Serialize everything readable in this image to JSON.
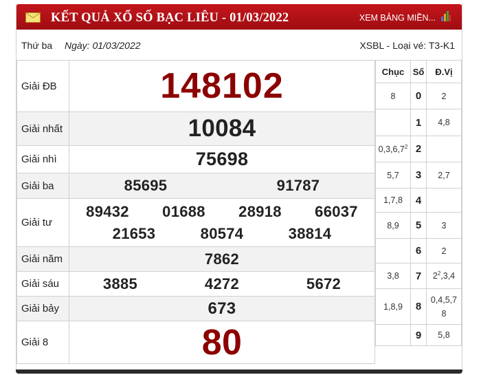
{
  "header": {
    "title": "KẾT QUẢ XỔ SỐ BẠC LIÊU - 01/03/2022",
    "more_link": "XEM BẢNG MIỀN...",
    "accent_color": "#c4161c"
  },
  "info": {
    "day": "Thứ ba",
    "date": "Ngày: 01/03/2022",
    "ticket": "XSBL - Loại vé: T3-K1"
  },
  "prizes": {
    "db": {
      "label": "Giải ĐB",
      "numbers": [
        "148102"
      ]
    },
    "g1": {
      "label": "Giải nhất",
      "numbers": [
        "10084"
      ]
    },
    "g2": {
      "label": "Giải nhì",
      "numbers": [
        "75698"
      ]
    },
    "g3": {
      "label": "Giải ba",
      "numbers": [
        "85695",
        "91787"
      ]
    },
    "g4": {
      "label": "Giải tư",
      "numbers": [
        "89432",
        "01688",
        "28918",
        "66037",
        "21653",
        "80574",
        "38814"
      ]
    },
    "g5": {
      "label": "Giải năm",
      "numbers": [
        "7862"
      ]
    },
    "g6": {
      "label": "Giải sáu",
      "numbers": [
        "3885",
        "4272",
        "5672"
      ]
    },
    "g7": {
      "label": "Giải bảy",
      "numbers": [
        "673"
      ]
    },
    "g8": {
      "label": "Giải 8",
      "numbers": [
        "80"
      ]
    }
  },
  "loto": {
    "headers": {
      "chuc": "Chục",
      "so": "Số",
      "dv": "Đ.Vị"
    },
    "rows": [
      {
        "chuc": "8",
        "so": "0",
        "dv": "2"
      },
      {
        "chuc": "",
        "so": "1",
        "dv": "4,8"
      },
      {
        "chuc": "0,3,6,7",
        "chuc_sup": "2",
        "so": "2",
        "dv": ""
      },
      {
        "chuc": "5,7",
        "so": "3",
        "dv": "2,7"
      },
      {
        "chuc": "1,7,8",
        "so": "4",
        "dv": ""
      },
      {
        "chuc": "8,9",
        "so": "5",
        "dv": "3"
      },
      {
        "chuc": "",
        "so": "6",
        "dv": "2"
      },
      {
        "chuc": "3,8",
        "so": "7",
        "dv_pre": "2",
        "dv_sup": "2",
        "dv": ",3,4"
      },
      {
        "chuc": "1,8,9",
        "so": "8",
        "dv": "0,4,5,7",
        "dv2": "8"
      },
      {
        "chuc": "",
        "so": "9",
        "dv": "5,8"
      }
    ]
  }
}
